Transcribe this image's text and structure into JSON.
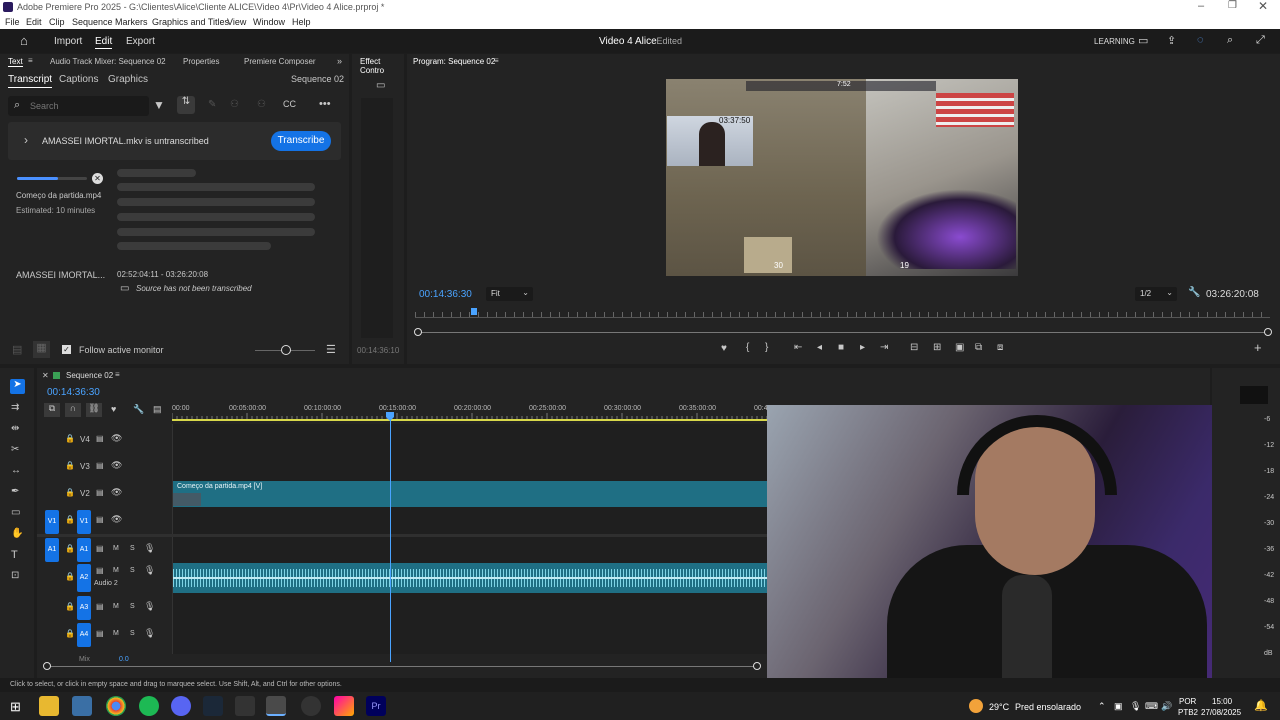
{
  "window": {
    "title": "Adobe Premiere Pro 2025 - G:\\Clientes\\Alice\\Cliente ALICE\\Video 4\\Pr\\Video 4 Alice.prproj *"
  },
  "menu": [
    "File",
    "Edit",
    "Clip",
    "Sequence",
    "Markers",
    "Graphics and Titles",
    "View",
    "Window",
    "Help"
  ],
  "topbar": {
    "import": "Import",
    "edit": "Edit",
    "export": "Export",
    "project_title": "Video 4 Alice",
    "project_status": "- Edited",
    "learning": "LEARNING"
  },
  "panel_tabs": {
    "text": "Text",
    "audio_mixer": "Audio Track Mixer: Sequence 02",
    "properties": "Properties",
    "composer": "Premiere Composer",
    "effect_controls": "Effect Contro",
    "program": "Program: Sequence 02"
  },
  "text_panel": {
    "tabs": [
      "Transcript",
      "Captions",
      "Graphics"
    ],
    "sequence": "Sequence 02",
    "search_placeholder": "Search",
    "untranscribed": "AMASSEI IMORTAL.mkv is untranscribed",
    "transcribe_button": "Transcribe",
    "progress_file": "Começo da partida.mp4",
    "progress_estimate": "Estimated: 10 minutes",
    "progress_fraction": 0.58,
    "clip_name": "AMASSEI IMORTAL...",
    "clip_range": "02:52:04:11 - 03:26:20:08",
    "clip_note": "Source has not been transcribed",
    "follow_monitor": "Follow active monitor"
  },
  "effect_panel": {
    "timecode": "00:14:36:10"
  },
  "program": {
    "timecode": "00:14:36:30",
    "fit": "Fit",
    "resolution": "1/2",
    "duration": "03:26:20:08",
    "overlay_time": "03:37:50",
    "hud_score": "7:52",
    "hud_hp": "30",
    "hud_ammo": "19"
  },
  "timeline": {
    "sequence": "Sequence 02",
    "timecode": "00:14:36:30",
    "ruler": [
      "00:00",
      "00:05:00:00",
      "00:10:00:00",
      "00:15:00:00",
      "00:20:00:00",
      "00:25:00:00",
      "00:30:00:00",
      "00:35:00:00",
      "00:4"
    ],
    "video_tracks": [
      "V4",
      "V3",
      "V2",
      "V1"
    ],
    "audio_tracks": [
      "A1",
      "A2",
      "A3",
      "A4"
    ],
    "audio2_name": "Audio 2",
    "mix_label": "Mix",
    "mix_value": "0.0",
    "clip_label": "Começo da partida.mp4 [V]",
    "mute": "M",
    "solo": "S"
  },
  "meter": {
    "scale": [
      "-6",
      "-12",
      "-18",
      "-24",
      "-30",
      "-36",
      "-42",
      "-48",
      "-54",
      "dB"
    ]
  },
  "status": {
    "hint": "Click to select, or click in empty space and drag to marquee select. Use Shift, Alt, and Ctrl for other options."
  },
  "taskbar": {
    "weather_temp": "29°C",
    "weather_desc": "Pred ensolarado",
    "lang1": "POR",
    "lang2": "PTB2",
    "time": "15:00",
    "date": "27/08/2025"
  },
  "colors": {
    "accent": "#1473e6",
    "clip_teal": "#1f6f84",
    "playhead": "#4aa3ff"
  }
}
